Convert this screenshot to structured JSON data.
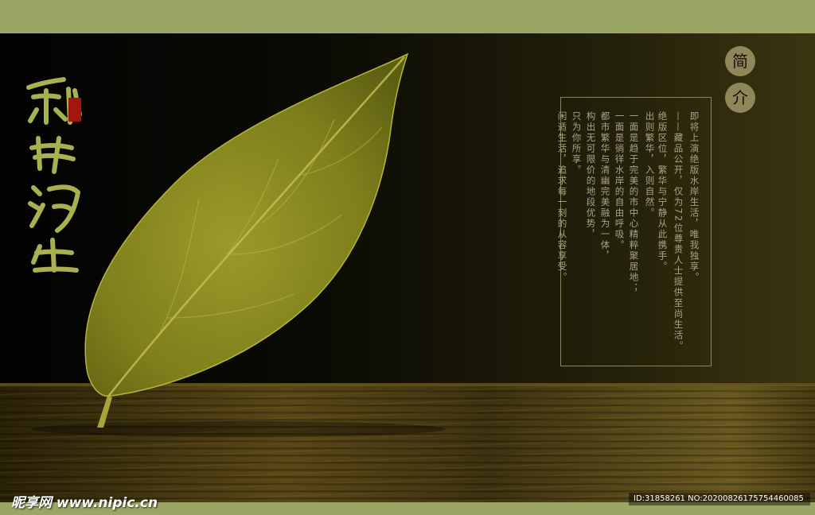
{
  "title": {
    "calligraphy": "乐享人生",
    "seal_text": "印"
  },
  "intro": {
    "heading_char1": "简",
    "heading_char2": "介",
    "lines": [
      "即将上演绝版水岸生活，唯我独享。",
      "——藏品公开，仅为72位尊贵人士提供至尚生活。",
      "绝版区位，繁华与宁静从此携手。",
      "出则繁华，入则自然。",
      "一面是趋于完美的市中心精粹聚居地；",
      "一面是徜徉水岸的自由呼吸。",
      "都市繁华与清幽完美融为一体，",
      "构出无可限价的地段优势，",
      "只为你所享。",
      "闲适生活，追求每一刻的从容享受。"
    ]
  },
  "watermark": {
    "logo": "昵享网 www.nipic.cn",
    "id_text": "ID:31858261 NO:20200826175754460085"
  },
  "colors": {
    "frame_bar": "#9ba564",
    "leaf": "#8a8a1e",
    "circle": "#8f8659",
    "text": "#a9a386",
    "seal": "#a3150f"
  },
  "icons": {
    "leaf": "leaf-icon",
    "seal": "seal-stamp"
  }
}
